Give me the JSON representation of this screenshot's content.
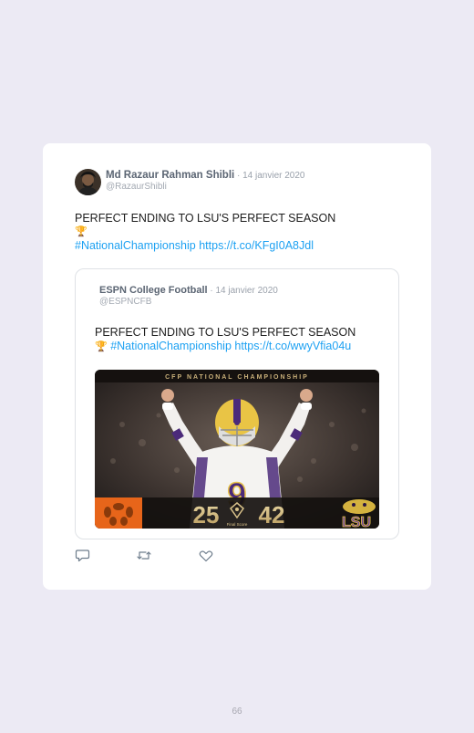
{
  "tweet": {
    "author_name": "Md Razaur Rahman Shibli",
    "date": " · 14 janvier 2020",
    "handle": "@RazaurShibli",
    "text_line1": "PERFECT ENDING TO LSU'S PERFECT SEASON",
    "emoji": "🏆",
    "hashtag": "#NationalChampionship",
    "url": "https://t.co/KFgI0A8Jdl"
  },
  "quote": {
    "author_name": "ESPN College Football",
    "date": " · 14 janvier 2020",
    "handle": "@ESPNCFB",
    "text_line1": "PERFECT ENDING TO LSU'S PERFECT SEASON",
    "emoji": "🏆",
    "hashtag": "#NationalChampionship",
    "url": "https://t.co/wwyVfia04u",
    "media": {
      "banner": "CFP NATIONAL CHAMPIONSHIP",
      "score_left": "25",
      "score_right": "42",
      "final_label": "Final Score",
      "team_right_logo": "LSU",
      "jersey_number": "9"
    }
  },
  "actions": {
    "reply_icon": "reply-icon",
    "retweet_icon": "retweet-icon",
    "like_icon": "like-icon"
  },
  "page": {
    "number": "66"
  }
}
